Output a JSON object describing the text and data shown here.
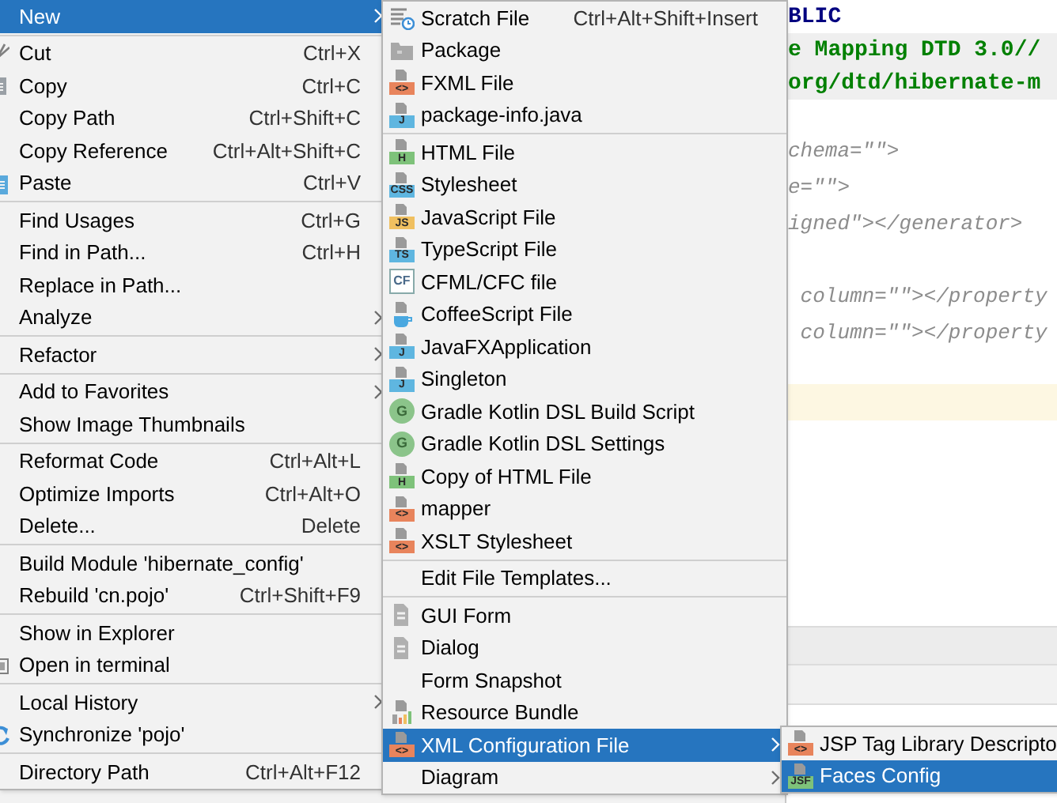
{
  "editor": {
    "doctype": [
      {
        "kind": "keyword",
        "text": "BLIC"
      },
      {
        "kind": "string",
        "text": "e Mapping DTD 3.0//"
      },
      {
        "kind": "string",
        "text": "org/dtd/hibernate-m"
      }
    ],
    "groups": [
      [
        "chema=\"\">",
        "e=\"\">",
        "igned\"></generator>"
      ],
      [
        " column=\"\"></property",
        " column=\"\"></property"
      ]
    ]
  },
  "context_menu": [
    {
      "kind": "item",
      "label": "New",
      "submenu": true,
      "selected": true
    },
    {
      "kind": "separator"
    },
    {
      "kind": "item",
      "label": "Cut",
      "shortcut": "Ctrl+X",
      "selected": false
    },
    {
      "kind": "item",
      "label": "Copy",
      "shortcut": "Ctrl+C",
      "selected": false
    },
    {
      "kind": "item",
      "label": "Copy Path",
      "shortcut": "Ctrl+Shift+C",
      "selected": false
    },
    {
      "kind": "item",
      "label": "Copy Reference",
      "shortcut": "Ctrl+Alt+Shift+C",
      "selected": false
    },
    {
      "kind": "item",
      "label": "Paste",
      "shortcut": "Ctrl+V",
      "selected": false
    },
    {
      "kind": "separator"
    },
    {
      "kind": "item",
      "label": "Find Usages",
      "shortcut": "Ctrl+G",
      "selected": false
    },
    {
      "kind": "item",
      "label": "Find in Path...",
      "shortcut": "Ctrl+H",
      "selected": false
    },
    {
      "kind": "item",
      "label": "Replace in Path...",
      "selected": false
    },
    {
      "kind": "item",
      "label": "Analyze",
      "submenu": true,
      "selected": false
    },
    {
      "kind": "separator"
    },
    {
      "kind": "item",
      "label": "Refactor",
      "submenu": true,
      "selected": false
    },
    {
      "kind": "separator"
    },
    {
      "kind": "item",
      "label": "Add to Favorites",
      "submenu": true,
      "selected": false
    },
    {
      "kind": "item",
      "label": "Show Image Thumbnails",
      "selected": false
    },
    {
      "kind": "separator"
    },
    {
      "kind": "item",
      "label": "Reformat Code",
      "shortcut": "Ctrl+Alt+L",
      "selected": false
    },
    {
      "kind": "item",
      "label": "Optimize Imports",
      "shortcut": "Ctrl+Alt+O",
      "selected": false
    },
    {
      "kind": "item",
      "label": "Delete...",
      "shortcut": "Delete",
      "selected": false
    },
    {
      "kind": "separator"
    },
    {
      "kind": "item",
      "label": "Build Module 'hibernate_config'",
      "selected": false
    },
    {
      "kind": "item",
      "label": "Rebuild 'cn.pojo'",
      "shortcut": "Ctrl+Shift+F9",
      "selected": false
    },
    {
      "kind": "separator"
    },
    {
      "kind": "item",
      "label": "Show in Explorer",
      "selected": false
    },
    {
      "kind": "item",
      "label": "Open in terminal",
      "selected": false
    },
    {
      "kind": "separator"
    },
    {
      "kind": "item",
      "label": "Local History",
      "submenu": true,
      "selected": false
    },
    {
      "kind": "item",
      "label": "Synchronize 'pojo'",
      "selected": false
    },
    {
      "kind": "separator"
    },
    {
      "kind": "item",
      "label": "Directory Path",
      "shortcut": "Ctrl+Alt+F12",
      "selected": false
    }
  ],
  "new_submenu": [
    {
      "kind": "item",
      "label": "Scratch File",
      "shortcut": "Ctrl+Alt+Shift+Insert",
      "selected": false
    },
    {
      "kind": "item",
      "label": "Package",
      "selected": false
    },
    {
      "kind": "item",
      "label": "FXML File",
      "badge": "<>",
      "selected": false
    },
    {
      "kind": "item",
      "label": "package-info.java",
      "badge": "J",
      "selected": false
    },
    {
      "kind": "separator"
    },
    {
      "kind": "item",
      "label": "HTML File",
      "badge": "H",
      "selected": false
    },
    {
      "kind": "item",
      "label": "Stylesheet",
      "badge": "CSS",
      "selected": false
    },
    {
      "kind": "item",
      "label": "JavaScript File",
      "badge": "JS",
      "selected": false
    },
    {
      "kind": "item",
      "label": "TypeScript File",
      "badge": "TS",
      "selected": false
    },
    {
      "kind": "item",
      "label": "CFML/CFC file",
      "badge": "CF",
      "selected": false
    },
    {
      "kind": "item",
      "label": "CoffeeScript File",
      "selected": false
    },
    {
      "kind": "item",
      "label": "JavaFXApplication",
      "badge": "J",
      "selected": false
    },
    {
      "kind": "item",
      "label": "Singleton",
      "badge": "J",
      "selected": false
    },
    {
      "kind": "item",
      "label": "Gradle Kotlin DSL Build Script",
      "badge": "G",
      "selected": false
    },
    {
      "kind": "item",
      "label": "Gradle Kotlin DSL Settings",
      "badge": "G",
      "selected": false
    },
    {
      "kind": "item",
      "label": "Copy of HTML File",
      "badge": "H",
      "selected": false
    },
    {
      "kind": "item",
      "label": "mapper",
      "badge": "<>",
      "selected": false
    },
    {
      "kind": "item",
      "label": "XSLT Stylesheet",
      "badge": "<>",
      "selected": false
    },
    {
      "kind": "separator"
    },
    {
      "kind": "item",
      "label": "Edit File Templates...",
      "selected": false
    },
    {
      "kind": "separator"
    },
    {
      "kind": "item",
      "label": "GUI Form",
      "selected": false
    },
    {
      "kind": "item",
      "label": "Dialog",
      "selected": false
    },
    {
      "kind": "item",
      "label": "Form Snapshot",
      "selected": false
    },
    {
      "kind": "item",
      "label": "Resource Bundle",
      "selected": false
    },
    {
      "kind": "item",
      "label": "XML Configuration File",
      "submenu": true,
      "badge": "<>",
      "selected": true
    },
    {
      "kind": "item",
      "label": "Diagram",
      "submenu": true,
      "selected": false
    }
  ],
  "xml_submenu": [
    {
      "kind": "item",
      "label": "JSP Tag Library Descripto",
      "badge": "<>",
      "selected": false
    },
    {
      "kind": "item",
      "label": "Faces Config",
      "badge": "JSF",
      "selected": true
    }
  ]
}
